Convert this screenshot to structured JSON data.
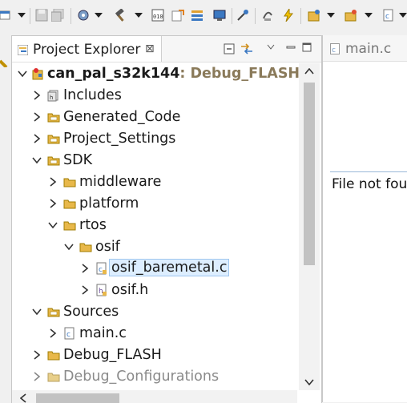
{
  "explorer": {
    "title": "Project Explorer",
    "close_glyph": "⊠"
  },
  "tree": {
    "project": {
      "name": "can_pal_s32k144",
      "config": ": Debug_FLASH"
    },
    "items": [
      {
        "label": "Includes",
        "icon": "includes-icon"
      },
      {
        "label": "Generated_Code",
        "icon": "source-folder-icon"
      },
      {
        "label": "Project_Settings",
        "icon": "source-folder-icon"
      },
      {
        "label": "SDK",
        "icon": "source-folder-icon"
      },
      {
        "label": "middleware",
        "icon": "folder-icon"
      },
      {
        "label": "platform",
        "icon": "folder-icon"
      },
      {
        "label": "rtos",
        "icon": "folder-icon"
      },
      {
        "label": "osif",
        "icon": "folder-icon"
      },
      {
        "label": "osif_baremetal.c",
        "icon": "c-file-icon"
      },
      {
        "label": "osif.h",
        "icon": "h-file-icon"
      },
      {
        "label": "Sources",
        "icon": "source-folder-icon"
      },
      {
        "label": "main.c",
        "icon": "c-file-icon"
      },
      {
        "label": "Debug_FLASH",
        "icon": "folder-icon"
      },
      {
        "label": "Debug_Configurations",
        "icon": "folder-icon"
      }
    ]
  },
  "editor": {
    "tab_label": "main.c",
    "message": "File not fou"
  },
  "colors": {
    "selection_bg": "#ddeeff",
    "selection_border": "#9fc6ee",
    "project_config": "#8a7a5a",
    "folder": "#e8b84a"
  }
}
